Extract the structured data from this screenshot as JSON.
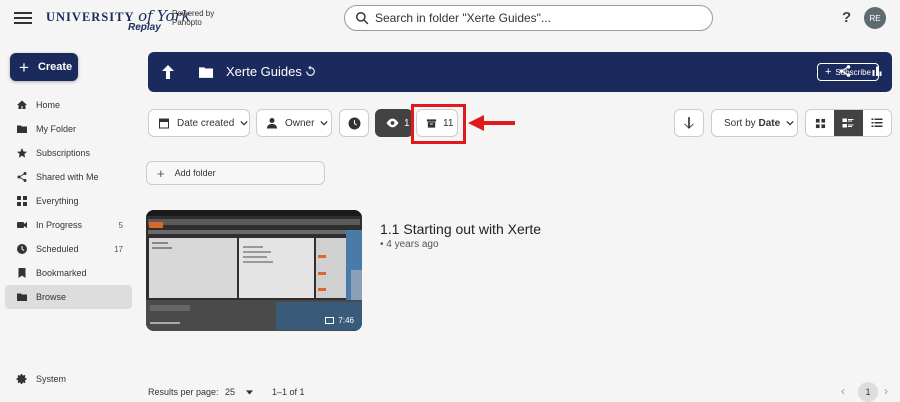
{
  "header": {
    "logo_university": "UNIVERSITY",
    "logo_of": "of",
    "logo_york": "York",
    "logo_replay": "Replay",
    "powered_by": "Powered by Panopto",
    "search_placeholder": "Search in folder \"Xerte Guides\"...",
    "help": "?",
    "avatar_initials": "RE"
  },
  "sidebar": {
    "create_label": "Create",
    "items": [
      {
        "label": "Home",
        "icon": "home-icon"
      },
      {
        "label": "My Folder",
        "icon": "folder-icon"
      },
      {
        "label": "Subscriptions",
        "icon": "star-icon"
      },
      {
        "label": "Shared with Me",
        "icon": "share-icon"
      },
      {
        "label": "Everything",
        "icon": "grid-icon"
      },
      {
        "label": "In Progress",
        "icon": "video-icon",
        "count": "5"
      },
      {
        "label": "Scheduled",
        "icon": "clock-icon",
        "count": "17"
      },
      {
        "label": "Bookmarked",
        "icon": "bookmark-icon"
      },
      {
        "label": "Browse",
        "icon": "folder-icon",
        "active": true
      }
    ],
    "system_label": "System"
  },
  "folder": {
    "title": "Xerte Guides",
    "subscribe_label": "Subscribe"
  },
  "filters": {
    "date_created": "Date created",
    "owner": "Owner",
    "views_count": "1",
    "archive_count": "11",
    "sort_by_prefix": "Sort by",
    "sort_by_value": "Date"
  },
  "add_folder_label": "Add folder",
  "session": {
    "title": "1.1 Starting out with Xerte",
    "meta": "• 4 years ago",
    "duration": "7:46"
  },
  "footer": {
    "results_per_page_label": "Results per page:",
    "results_per_page_value": "25",
    "range": "1–1 of 1",
    "current_page": "1"
  },
  "colors": {
    "brand_navy": "#1a2a5c",
    "highlight_red": "#e01a1a",
    "active_dark": "#424242"
  }
}
